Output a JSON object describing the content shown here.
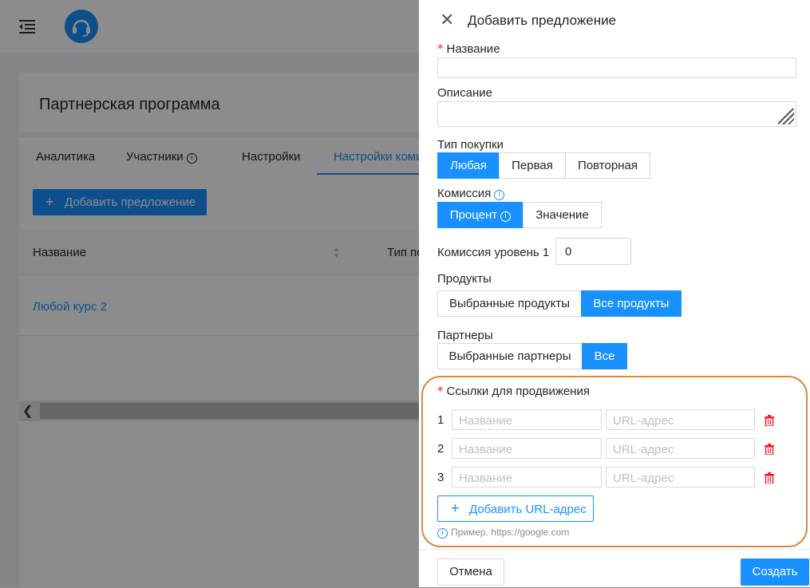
{
  "background": {
    "page_title": "Партнерская программа",
    "tabs": [
      {
        "label": "Аналитика"
      },
      {
        "label": "Участники"
      },
      {
        "label": "Настройки"
      },
      {
        "label": "Настройки коми"
      }
    ],
    "add_offer_label": "Добавить предложение",
    "table": {
      "col_name": "Название",
      "col_type": "Тип по",
      "rows": [
        {
          "name": "Любой курс 2"
        }
      ]
    }
  },
  "drawer": {
    "title": "Добавить предложение",
    "name_label": "Название",
    "description_label": "Описание",
    "purchase_type": {
      "label": "Тип покупки",
      "options": [
        "Любая",
        "Первая",
        "Повторная"
      ],
      "selected": "Любая"
    },
    "commission": {
      "label": "Комиссия",
      "options": [
        "Процент",
        "Значение"
      ],
      "selected": "Процент"
    },
    "commission_level": {
      "label": "Комиссия уровень 1",
      "value": "0"
    },
    "products": {
      "label": "Продукты",
      "options": [
        "Выбранные продукты",
        "Все продукты"
      ],
      "selected": "Все продукты"
    },
    "partners": {
      "label": "Партнеры",
      "options": [
        "Выбранные партнеры",
        "Все"
      ],
      "selected": "Все"
    },
    "links": {
      "label": "Ссылки для продвижения",
      "rows": [
        {
          "num": "1",
          "name_placeholder": "Название",
          "url_placeholder": "URL-адрес"
        },
        {
          "num": "2",
          "name_placeholder": "Название",
          "url_placeholder": "URL-адрес"
        },
        {
          "num": "3",
          "name_placeholder": "Название",
          "url_placeholder": "URL-адрес"
        }
      ],
      "add_label": "Добавить URL-адрес",
      "hint": "Пример. https://google.com"
    },
    "cancel_label": "Отмена",
    "create_label": "Создать"
  },
  "colors": {
    "primary": "#1890ff",
    "danger": "#f5222d",
    "highlight": "#d98b3a"
  }
}
